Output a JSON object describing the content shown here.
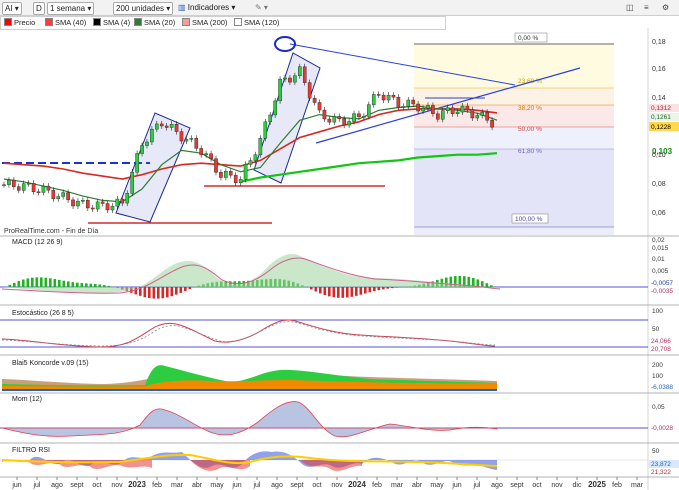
{
  "toolbar": {
    "symbol": "AI",
    "d_label": "D",
    "period": "1 semana",
    "units": "200 unidades",
    "indicators_label": "Indicadores"
  },
  "legend": {
    "items": [
      {
        "label": "Precio",
        "color": "#ff0000"
      },
      {
        "label": "SMA (40)",
        "color": "#ff3a3a"
      },
      {
        "label": "SMA (4)",
        "color": "#000000"
      },
      {
        "label": "SMA (20)",
        "color": "#2e7d32"
      },
      {
        "label": "SMA (200)",
        "color": "#ff9999"
      },
      {
        "label": "SMA (120)",
        "color": "#ffffff"
      }
    ]
  },
  "source": "ProRealTime.com - Fin de Día",
  "fib_levels": [
    "0,00 %",
    "23,60 %",
    "38,20 %",
    "50,00 %",
    "61,80 %",
    "100,00 %"
  ],
  "right_tags": [
    "0,1312",
    "0,1261",
    "0,1228",
    "0,103"
  ],
  "panels": {
    "macd": {
      "label": "MACD (12 26 9)",
      "tags": [
        "-0,0057",
        "-0,0035"
      ]
    },
    "stoch": {
      "label": "Estocástico (26 8 5)",
      "tags": [
        "24,066",
        "20,708"
      ]
    },
    "koncorde": {
      "label": "Blai5 Koncorde v.09 (15)",
      "tags": [
        "-6,0388"
      ]
    },
    "mom": {
      "label": "Mom (12)",
      "tags": [
        "-0,0028"
      ]
    },
    "rsi": {
      "label": "FILTRO RSI",
      "tags": [
        "23,872",
        "21,322"
      ]
    }
  },
  "colors": {
    "up": "#2ecc40",
    "down": "#e53935",
    "sma200": "#00cc00",
    "sma40": "#e0392b"
  },
  "chart_data": {
    "type": "line",
    "title": "",
    "x_ticks": [
      "jun",
      "jul",
      "ago",
      "sept",
      "oct",
      "nov",
      "2023",
      "feb",
      "mar",
      "abr",
      "may",
      "jun",
      "jul",
      "ago",
      "sept",
      "oct",
      "nov",
      "2024",
      "feb",
      "mar",
      "abr",
      "may",
      "jun",
      "jul",
      "ago",
      "sept",
      "oct",
      "nov",
      "dic",
      "2025",
      "feb",
      "mar"
    ],
    "main": {
      "y_ticks": [
        "0,18",
        "0,16",
        "0,14",
        "0,12",
        "0,10",
        "0,08",
        "0,06"
      ],
      "ylim": [
        0.05,
        0.185
      ],
      "x": [
        "2022-06",
        "2022-07",
        "2022-08",
        "2022-09",
        "2022-10",
        "2022-11",
        "2022-12",
        "2023-01",
        "2023-02",
        "2023-03",
        "2023-04",
        "2023-05",
        "2023-06",
        "2023-07",
        "2023-08",
        "2023-09",
        "2023-10",
        "2023-11",
        "2023-12",
        "2024-01",
        "2024-02",
        "2024-03",
        "2024-04",
        "2024-05",
        "2024-06",
        "2024-07"
      ],
      "series": [
        {
          "name": "Precio",
          "values": [
            0.081,
            0.08,
            0.077,
            0.072,
            0.067,
            0.066,
            0.068,
            0.11,
            0.125,
            0.115,
            0.105,
            0.088,
            0.085,
            0.112,
            0.152,
            0.16,
            0.13,
            0.125,
            0.128,
            0.145,
            0.138,
            0.136,
            0.13,
            0.134,
            0.13,
            0.1228
          ]
        },
        {
          "name": "SMA (40)",
          "values": [
            0.096,
            0.095,
            0.094,
            0.092,
            0.089,
            0.087,
            0.085,
            0.088,
            0.092,
            0.095,
            0.096,
            0.095,
            0.094,
            0.098,
            0.106,
            0.114,
            0.118,
            0.122,
            0.125,
            0.13,
            0.133,
            0.134,
            0.134,
            0.134,
            0.133,
            0.1312
          ]
        },
        {
          "name": "SMA (20)",
          "values": [
            0.085,
            0.083,
            0.08,
            0.077,
            0.073,
            0.07,
            0.069,
            0.078,
            0.095,
            0.105,
            0.103,
            0.095,
            0.09,
            0.093,
            0.11,
            0.126,
            0.13,
            0.128,
            0.127,
            0.133,
            0.135,
            0.136,
            0.134,
            0.133,
            0.131,
            0.1261
          ]
        },
        {
          "name": "SMA (200)",
          "values": [
            null,
            null,
            null,
            null,
            null,
            null,
            null,
            null,
            null,
            null,
            null,
            null,
            0.083,
            0.086,
            0.088,
            0.09,
            0.092,
            0.094,
            0.096,
            0.097,
            0.098,
            0.1,
            0.101,
            0.102,
            0.102,
            0.103
          ]
        }
      ],
      "annotations": {
        "triangle": {
          "top_left": [
            "2023-10",
            0.128
          ],
          "top_right": [
            "2024-08",
            0.151
          ],
          "bottom_left": [
            "2023-10",
            0.12
          ],
          "bottom_right": [
            "2024-08",
            0.145
          ]
        },
        "upper_trendline": [
          [
            "2023-08",
            0.177
          ],
          [
            "2024-07",
            0.153
          ]
        ],
        "dashed_support": 0.097,
        "support_line_red": 0.08,
        "support_line_low": 0.059,
        "fib_range": [
          0.178,
          0.052
        ]
      }
    },
    "macd": {
      "y_ticks": [
        "0,02",
        "0,015",
        "0,01",
        "0,005",
        "0",
        "-0,005"
      ],
      "tags": [
        "-0,0057",
        "-0,0035"
      ]
    },
    "stochastic": {
      "y_ticks": [
        "100",
        "50"
      ],
      "tags": [
        "24,066",
        "20,708"
      ]
    },
    "koncorde": {
      "y_ticks": [
        "200",
        "100"
      ],
      "tags": [
        "-6,0388"
      ]
    },
    "momentum": {
      "y_ticks": [
        "0,05",
        "0"
      ],
      "tags": [
        "-0,0028"
      ]
    },
    "rsi": {
      "y_ticks": [
        "50"
      ],
      "tags": [
        "23,872",
        "21,322"
      ]
    }
  }
}
